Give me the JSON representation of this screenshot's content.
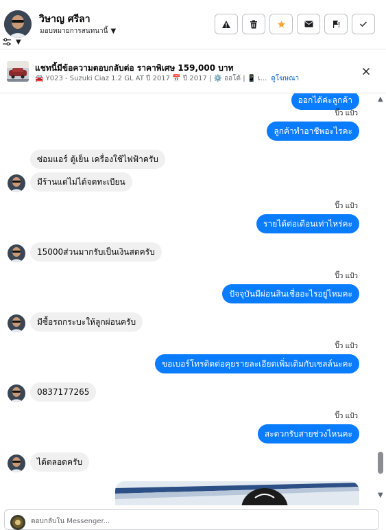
{
  "header": {
    "name": "วิษาญ ศรีลา",
    "assign_label": "มอบหมายการสนทนานี้",
    "actions": [
      {
        "name": "report-button",
        "icon": "warning-icon"
      },
      {
        "name": "delete-button",
        "icon": "trash-icon"
      },
      {
        "name": "star-button",
        "icon": "star-icon"
      },
      {
        "name": "unread-button",
        "icon": "envelope-icon"
      },
      {
        "name": "spam-button",
        "icon": "flag-spam-icon"
      },
      {
        "name": "done-button",
        "icon": "check-icon"
      }
    ]
  },
  "ad": {
    "title": "แชทนี้มีข้อความตอบกลับต่อ ราคาพิเศษ 159,000 บาท",
    "details": "🚘 Y023 - Suzuki Ciaz 1.2 GL AT ปี 2017 📅 ปี 2017 | ⚙️ ออโต้ | 📱 เ...",
    "link": "ดูโฆษณา"
  },
  "messages": [
    {
      "dir": "out",
      "text": "ออกได้ค่ะลูกค้า"
    },
    {
      "dir": "seen",
      "text": "ปิ๊ว แป้ว"
    },
    {
      "dir": "out",
      "text": "ลูกค้าทำอาชีพอะไรคะ"
    },
    {
      "dir": "in",
      "text": "ซ่อมแอร์ ตู้เย็น เครื่องใช้ไฟฟ้าครับ"
    },
    {
      "dir": "in",
      "text": "มีร้านแต่ไม่ได้จดทะเบียน"
    },
    {
      "dir": "seen",
      "text": "ปิ๊ว แป้ว"
    },
    {
      "dir": "out",
      "text": "รายได้ต่อเดือนเท่าไหร่คะ"
    },
    {
      "dir": "in",
      "text": "15000ส่วนมากรับเป็นเงินสดครับ"
    },
    {
      "dir": "seen",
      "text": "ปิ๊ว แป้ว"
    },
    {
      "dir": "out",
      "text": "ปัจจุบันมีผ่อนสินเชื่ออะไรอยู่ไหมคะ"
    },
    {
      "dir": "in",
      "text": "มีซื้อรถกระบะให้ลูกผ่อนครับ"
    },
    {
      "dir": "seen",
      "text": "ปิ๊ว แป้ว"
    },
    {
      "dir": "out",
      "text": "ขอเบอร์โทรติดต่อคุยรายละเอียดเพิ่มเติมกับเซลล์นะคะ"
    },
    {
      "dir": "in",
      "text": "0837177265"
    },
    {
      "dir": "seen",
      "text": "ปิ๊ว แป้ว"
    },
    {
      "dir": "out",
      "text": "สะดวกรับสายช่วงไหนคะ"
    },
    {
      "dir": "in",
      "text": "ได้ตลอดครับ"
    }
  ],
  "composer": {
    "placeholder": "ตอบกลับใน Messenger..."
  },
  "colors": {
    "outgoing_bubble": "#0a7cff",
    "incoming_bubble": "#f0f0f0",
    "star": "#f7a531",
    "link": "#0a66c2"
  }
}
